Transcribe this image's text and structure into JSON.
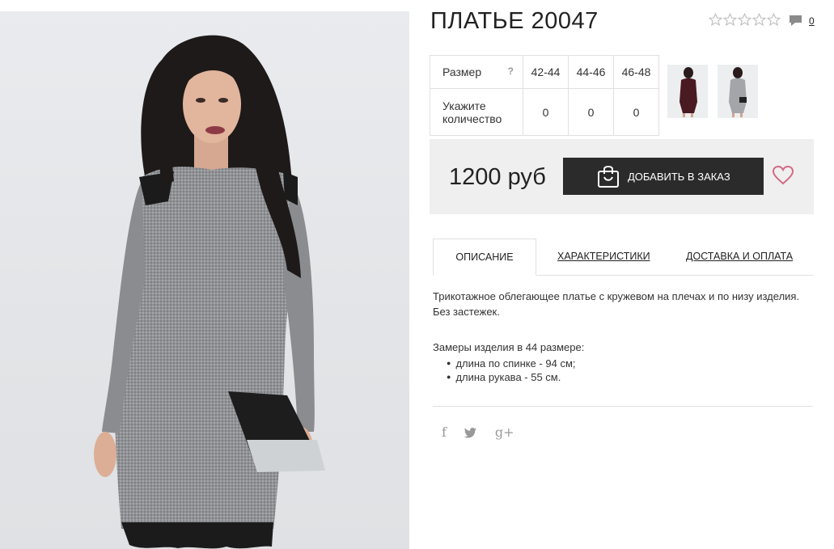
{
  "product": {
    "title": "ПЛАТЬЕ 20047",
    "comments_count": "0",
    "rating_stars": 5
  },
  "size_table": {
    "size_label": "Размер",
    "help": "?",
    "sizes": [
      "42-44",
      "44-46",
      "46-48"
    ],
    "qty_label_line1": "Укажите",
    "qty_label_line2": "количество",
    "quantities": [
      "0",
      "0",
      "0"
    ]
  },
  "thumbnails": [
    "burgundy-dress-thumbnail",
    "grey-dress-thumbnail"
  ],
  "purchase": {
    "price": "1200 руб",
    "add_button": "ДОБАВИТЬ В ЗАКАЗ"
  },
  "tabs": [
    "ОПИСАНИЕ",
    "ХАРАКТЕРИСТИКИ",
    "ДОСТАВКА И ОПЛАТА"
  ],
  "description": {
    "line1": "Трикотажное облегающее платье с кружевом на плечах и по низу изделия.",
    "line2": "Без застежек.",
    "measurements_title": "Замеры изделия в 44 размере:",
    "measurements": [
      "длина по спинке - 94 см;",
      "длина рукава - 55 см."
    ]
  },
  "social": {
    "facebook": "f",
    "twitter": "twitter-icon",
    "google": "g+"
  },
  "colors": {
    "dark_button": "#2b2b2b",
    "heart": "#d26a86",
    "price_bar": "#efefef"
  }
}
